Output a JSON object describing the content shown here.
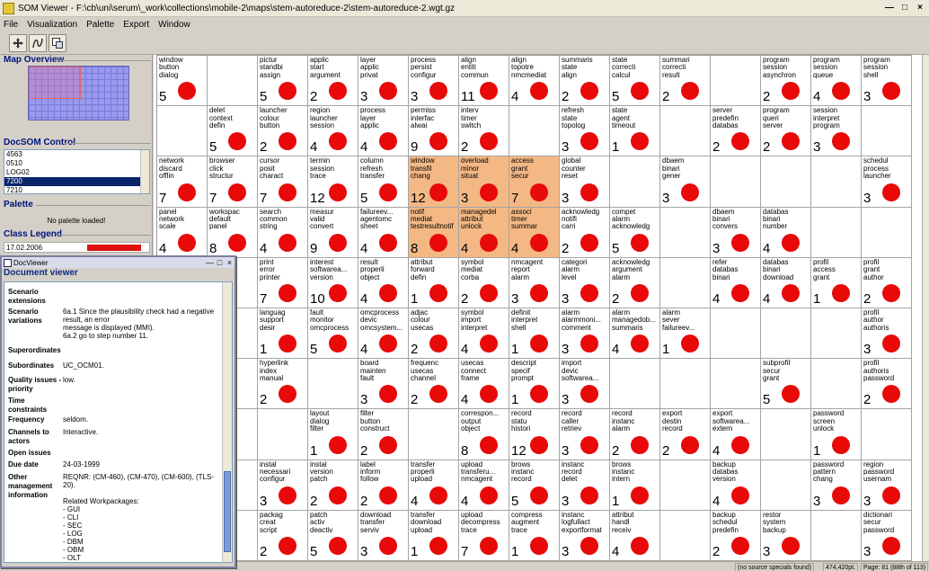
{
  "window": {
    "title": "SOM Viewer - F:\\cb\\uni\\serum\\_work\\collections\\mobile-2\\maps\\stem-autoreduce-2\\stem-autoreduce-2.wgt.gz",
    "buttons": [
      "—",
      "□",
      "×"
    ]
  },
  "menu": [
    "File",
    "Visualization",
    "Palette",
    "Export",
    "Window"
  ],
  "toolbar": {
    "icons": [
      "move-icon",
      "curve-icon",
      "window-icon"
    ]
  },
  "left": {
    "map_overview_title": "Map Overview",
    "docsom_title": "DocSOM Control",
    "doc_list": [
      "4563",
      "0510",
      "LOG02",
      "7200",
      "7210"
    ],
    "selected_doc": "7200",
    "palette_title": "Palette",
    "palette_msg": "No palette loaded!",
    "class_legend_title": "Class Legend",
    "legend_date": "17.02.2006",
    "legend_color": "#e01010"
  },
  "status": {
    "specials": "(no source specials found)",
    "coords": "474,420pt.",
    "page": "Page: 81 (88th of 113)"
  },
  "docviewer": {
    "window_title": "DocViewer",
    "heading": "Document viewer",
    "rows": [
      {
        "k": "Scenario extensions",
        "v": ""
      },
      {
        "k": "Scenario variations",
        "v": "6a.1 Since the plausibility check had a negative result, an error\nmessage is displayed (MMI).\n6a.2 go to step number 11."
      },
      {
        "k": "Superordinates",
        "v": ""
      },
      {
        "k": "Subordinates",
        "v": "UC_OCM01."
      },
      {
        "k": "Quality issues - priority",
        "v": "low."
      },
      {
        "k": "Time constraints",
        "v": ""
      },
      {
        "k": "Frequency",
        "v": "seldom."
      },
      {
        "k": "Channels to actors",
        "v": "Interactive."
      },
      {
        "k": "Open issues",
        "v": ""
      },
      {
        "k": "Due date",
        "v": "24-03-1999"
      },
      {
        "k": "Other management information",
        "v": "REQNR: (CM-460), (CM-470), (CM-600), (TLS-20).\n\nRelated Workpackages:\n- GUI\n- CLI\n- SEC\n- LOG\n- DBM\n- OBM\n- OLT"
      }
    ]
  },
  "map": {
    "cols": 15,
    "dot_color": "#e80909",
    "highlight_color": "#f4b885",
    "cells": [
      [
        {
          "w": "window\nbutton\ndialog",
          "n": "5"
        },
        {
          "w": "",
          "n": ""
        },
        {
          "w": "pictur\nstandbi\nassign",
          "n": "5"
        },
        {
          "w": "applic\nstart\nargument",
          "n": "2"
        },
        {
          "w": "layer\napplic\nprivat",
          "n": "3"
        },
        {
          "w": "process\npersist\nconfigur",
          "n": "3"
        },
        {
          "w": "align\nentiti\ncommun",
          "n": "11"
        },
        {
          "w": "align\ntopotre\nnmcmediat",
          "n": "4"
        },
        {
          "w": "summaris\nstate\nalign",
          "n": "2"
        },
        {
          "w": "state\ncorrecti\ncalcul",
          "n": "5"
        },
        {
          "w": "summari\ncorrecti\nresult",
          "n": "2"
        },
        {
          "w": "",
          "n": ""
        },
        {
          "w": "program\nsession\nasynchron",
          "n": "2"
        },
        {
          "w": "program\nsession\nqueue",
          "n": "4"
        },
        {
          "w": "program\nsession\nshell",
          "n": "3"
        }
      ],
      [
        {
          "w": "",
          "n": ""
        },
        {
          "w": "delet\ncontext\ndefin",
          "n": "5"
        },
        {
          "w": "launcher\ncolour\nbutton",
          "n": "2"
        },
        {
          "w": "region\nlauncher\nsession",
          "n": "4"
        },
        {
          "w": "process\nlayer\napplic",
          "n": "4"
        },
        {
          "w": "permiss\ninterfac\nalwai",
          "n": "9"
        },
        {
          "w": "interv\ntimer\nswitch",
          "n": "2"
        },
        {
          "w": "",
          "n": ""
        },
        {
          "w": "refresh\nstate\ntopolog",
          "n": "3"
        },
        {
          "w": "state\nagent\ntimeout",
          "n": "1"
        },
        {
          "w": "",
          "n": ""
        },
        {
          "w": "server\npredefin\ndatabas",
          "n": "2"
        },
        {
          "w": "program\nqueri\nserver",
          "n": "2"
        },
        {
          "w": "session\ninterpret\nprogram",
          "n": "3"
        },
        {
          "w": "",
          "n": ""
        }
      ],
      [
        {
          "w": "network\ndiscard\nofflin",
          "n": "7"
        },
        {
          "w": "browser\nclick\nstructur",
          "n": "7"
        },
        {
          "w": "cursor\nposit\ncharact",
          "n": "7"
        },
        {
          "w": "termin\nsession\ntrace",
          "n": "12"
        },
        {
          "w": "column\nrefresh\ntransfer",
          "n": "5"
        },
        {
          "w": "window\ntransfil\nchang",
          "n": "12",
          "hl": true
        },
        {
          "w": "overload\nminor\nsituat",
          "n": "3",
          "hl": true
        },
        {
          "w": "access\ngrant\nsecur",
          "n": "7",
          "hl": true
        },
        {
          "w": "global\ncounter\nreset",
          "n": "3"
        },
        {
          "w": "",
          "n": ""
        },
        {
          "w": "dbaem\nbinari\ngener",
          "n": "3"
        },
        {
          "w": "",
          "n": ""
        },
        {
          "w": "",
          "n": ""
        },
        {
          "w": "",
          "n": ""
        },
        {
          "w": "schedul\nprocess\nlauncher",
          "n": "3"
        }
      ],
      [
        {
          "w": "panel\nnetwork\nscale",
          "n": "4"
        },
        {
          "w": "workspac\ndefault\npanel",
          "n": "8"
        },
        {
          "w": "search\ncommon\nstring",
          "n": "4"
        },
        {
          "w": "measur\nvalid\nconvert",
          "n": "9"
        },
        {
          "w": "failureev...\nagentomc\nsheet",
          "n": "4"
        },
        {
          "w": "notif\nmediat\ntestresultnotif",
          "n": "8",
          "hl": true
        },
        {
          "w": "managedel\nattribut\nunlock",
          "n": "4",
          "hl": true
        },
        {
          "w": "associ\ntimer\nsummar",
          "n": "4",
          "hl": true
        },
        {
          "w": "acknowledg\nnotifi\ncarri",
          "n": "2"
        },
        {
          "w": "compet\nalarm\nacknowledg",
          "n": "5"
        },
        {
          "w": "",
          "n": ""
        },
        {
          "w": "dbaem\nbinari\nconvers",
          "n": "3"
        },
        {
          "w": "databas\nbinari\nnumber",
          "n": "4"
        },
        {
          "w": "",
          "n": ""
        },
        {
          "w": "",
          "n": ""
        }
      ],
      [
        {
          "w": "",
          "n": ""
        },
        {
          "w": "",
          "n": ""
        },
        {
          "w": "print\nerror\nprinter",
          "n": "7"
        },
        {
          "w": "interest\nsoftwarea...\nversion",
          "n": "10"
        },
        {
          "w": "result\nproperli\nobject",
          "n": "4"
        },
        {
          "w": "attribut\nforward\ndefin",
          "n": "1"
        },
        {
          "w": "symbol\nmediat\ncorba",
          "n": "2"
        },
        {
          "w": "nmcagent\nreport\nalarm",
          "n": "3"
        },
        {
          "w": "categori\nalarm\nlevel",
          "n": "3"
        },
        {
          "w": "acknowledg\nargument\nalarm",
          "n": "2"
        },
        {
          "w": "",
          "n": ""
        },
        {
          "w": "refer\ndatabas\nbinari",
          "n": "4"
        },
        {
          "w": "databas\nbinari\ndownload",
          "n": "4"
        },
        {
          "w": "profil\naccess\ngrant",
          "n": "1"
        },
        {
          "w": "profil\ngrant\nauthor",
          "n": "2"
        }
      ],
      [
        {
          "w": "",
          "n": ""
        },
        {
          "w": "",
          "n": ""
        },
        {
          "w": "languag\nsupport\ndesir",
          "n": "1"
        },
        {
          "w": "fault\nmonitor\nomcprocess",
          "n": "5"
        },
        {
          "w": "omcprocess\ndevic\nomcsystem...",
          "n": "4"
        },
        {
          "w": "adjac\ncolour\nusecas",
          "n": "2"
        },
        {
          "w": "symbol\nimport\ninterpret",
          "n": "4"
        },
        {
          "w": "definit\ninterpret\nshell",
          "n": "1"
        },
        {
          "w": "alarm\nalarmmoni...\ncomment",
          "n": "3"
        },
        {
          "w": "alarm\nmanagedob...\nsummaris",
          "n": "4"
        },
        {
          "w": "alarm\nsever\nfailureev...",
          "n": "1"
        },
        {
          "w": "",
          "n": ""
        },
        {
          "w": "",
          "n": ""
        },
        {
          "w": "",
          "n": ""
        },
        {
          "w": "profil\nauthor\nauthoris",
          "n": "3"
        }
      ],
      [
        {
          "w": "",
          "n": ""
        },
        {
          "w": "",
          "n": ""
        },
        {
          "w": "hyperlink\nindex\nmanual",
          "n": "2"
        },
        {
          "w": "",
          "n": ""
        },
        {
          "w": "board\nmainten\nfault",
          "n": "3"
        },
        {
          "w": "frequenc\nusecas\nchannel",
          "n": "2"
        },
        {
          "w": "usecas\nconnect\nframe",
          "n": "4"
        },
        {
          "w": "descript\nspecif\nprompt",
          "n": "1"
        },
        {
          "w": "import\ndevic\nsoftwarea...",
          "n": "3"
        },
        {
          "w": "",
          "n": ""
        },
        {
          "w": "",
          "n": ""
        },
        {
          "w": "",
          "n": ""
        },
        {
          "w": "subprofil\nsecur\ngrant",
          "n": "5"
        },
        {
          "w": "",
          "n": ""
        },
        {
          "w": "profil\nauthoris\npassword",
          "n": "2"
        }
      ],
      [
        {
          "w": "",
          "n": ""
        },
        {
          "w": "",
          "n": ""
        },
        {
          "w": "",
          "n": ""
        },
        {
          "w": "layout\ndialog\nfilter",
          "n": "1"
        },
        {
          "w": "filter\nbutton\nconstruct",
          "n": "2"
        },
        {
          "w": "",
          "n": ""
        },
        {
          "w": "correspon...\noutput\nobject",
          "n": "8"
        },
        {
          "w": "record\nstatu\nhistori",
          "n": "12"
        },
        {
          "w": "record\ncaller\nretriev",
          "n": "3"
        },
        {
          "w": "record\ninstanc\nalarm",
          "n": "2"
        },
        {
          "w": "export\ndestin\nrecord",
          "n": "2"
        },
        {
          "w": "export\nsoftwarea...\nextern",
          "n": "4"
        },
        {
          "w": "",
          "n": ""
        },
        {
          "w": "password\nscreen\nunlock",
          "n": "1"
        },
        {
          "w": "",
          "n": ""
        }
      ],
      [
        {
          "w": "",
          "n": ""
        },
        {
          "w": "",
          "n": ""
        },
        {
          "w": "instal\nnecessari\nconfigur",
          "n": "3"
        },
        {
          "w": "instal\nversion\npatch",
          "n": "2"
        },
        {
          "w": "label\ninform\nfollow",
          "n": "2"
        },
        {
          "w": "transfer\nproperli\nupload",
          "n": "4"
        },
        {
          "w": "upload\ntransferu...\nnmcagent",
          "n": "4"
        },
        {
          "w": "brows\ninstanc\nrecord",
          "n": "5"
        },
        {
          "w": "instanc\nrecord\ndelet",
          "n": "3"
        },
        {
          "w": "brows\ninstanc\nintern",
          "n": "1"
        },
        {
          "w": "",
          "n": ""
        },
        {
          "w": "backup\ndatabas\nversion",
          "n": "4"
        },
        {
          "w": "",
          "n": ""
        },
        {
          "w": "password\npattern\nchang",
          "n": "3"
        },
        {
          "w": "region\npassword\nusernam",
          "n": "3"
        }
      ],
      [
        {
          "w": "",
          "n": ""
        },
        {
          "w": "",
          "n": ""
        },
        {
          "w": "packag\ncreat\nscript",
          "n": "2"
        },
        {
          "w": "patch\nactiv\ndeactiv",
          "n": "5"
        },
        {
          "w": "download\ntransfer\nserviv",
          "n": "3"
        },
        {
          "w": "transfer\ndownload\nupload",
          "n": "1"
        },
        {
          "w": "upload\ndecompress\ntrace",
          "n": "7"
        },
        {
          "w": "compress\naugment\ntrace",
          "n": "1"
        },
        {
          "w": "instanc\nlogfullact\nexportformat",
          "n": "3"
        },
        {
          "w": "attribut\nhandl\nreceiv",
          "n": "4"
        },
        {
          "w": "",
          "n": ""
        },
        {
          "w": "backup\nschedul\npredefin",
          "n": "2"
        },
        {
          "w": "restor\nsystem\nbackup",
          "n": "3"
        },
        {
          "w": "",
          "n": ""
        },
        {
          "w": "dictionari\nsecur\npassword",
          "n": "3"
        }
      ]
    ]
  }
}
